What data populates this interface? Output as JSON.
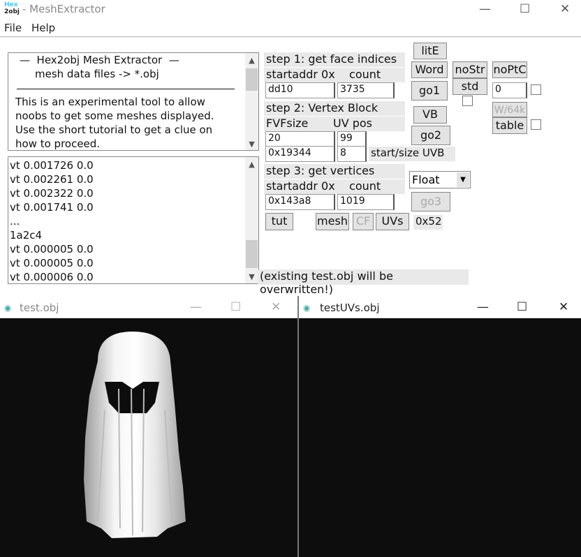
{
  "window": {
    "logo_top": "Hex",
    "logo_bottom": "2obj",
    "title": "- MeshExtractor",
    "min": "—",
    "max": "☐",
    "close": "✕"
  },
  "menu": [
    "File",
    "Help"
  ],
  "info": {
    "line1": "—  Hex2obj Mesh Extractor  —",
    "line2": "mesh data files -> *.obj",
    "line3": "This is an experimental tool to allow",
    "line4": "noobs to get some meshes displayed.",
    "line5": "Use the short tutorial to get a clue on",
    "line6": "how to proceed."
  },
  "log": [
    "vt 0.001726 0.0",
    "vt 0.002261 0.0",
    "vt 0.002322 0.0",
    "vt 0.001741 0.0",
    "...",
    "1a2c4",
    "vt 0.000005 0.0",
    "vt 0.000005 0.0",
    "vt 0.000006 0.0"
  ],
  "step1": {
    "label": "step 1: get face indices",
    "sub": "startaddr 0x    count",
    "startaddr": "dd10",
    "count": "3735"
  },
  "step2": {
    "label": "step 2: Vertex Block",
    "sub": "FVFsize       UV pos",
    "fvf": "20",
    "uvpos": "99",
    "addr": "0x19344",
    "size": "8",
    "size_label": "start/size UVB"
  },
  "step3": {
    "label": "step 3: get vertices",
    "sub": "startaddr 0x    count",
    "startaddr": "0x143a8",
    "count": "1019",
    "format": "Float",
    "hex": "0x52"
  },
  "buttons": {
    "lite": "litE",
    "word": "Word",
    "nostr": "noStr",
    "noptc": "noPtC",
    "go1": "go1",
    "std": "std",
    "vb": "VB",
    "w64k": "W/64k",
    "table": "table",
    "go2": "go2",
    "go3": "go3",
    "tut": "tut",
    "mesh": "mesh",
    "cf": "CF",
    "uvs": "UVs"
  },
  "fields": {
    "ptc": "0"
  },
  "warning": "(existing test.obj will be overwritten!)",
  "viewer1": {
    "title": "test.obj"
  },
  "viewer2": {
    "title": "testUVs.obj"
  }
}
